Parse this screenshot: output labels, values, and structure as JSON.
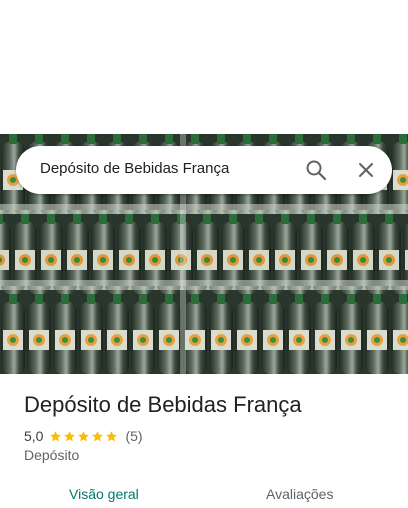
{
  "search": {
    "query": "Depósito de Bebidas França"
  },
  "hero": {
    "image_description_icon": "place-photo"
  },
  "place": {
    "title": "Depósito de Bebidas França",
    "rating": "5,0",
    "stars": 5,
    "review_count": "(5)",
    "category": "Depósito"
  },
  "tabs": [
    {
      "label": "Visão geral"
    },
    {
      "label": "Avaliações"
    }
  ],
  "colors": {
    "accent": "#00796b",
    "star": "#fbbc04",
    "text_primary": "#202124",
    "text_secondary": "#5f6368"
  }
}
